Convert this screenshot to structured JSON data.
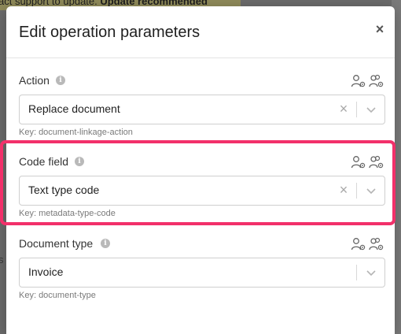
{
  "background": {
    "banner_text": "act support to update. ",
    "banner_bold": "Update recommended",
    "edge_letters": [
      "c",
      "s"
    ]
  },
  "modal": {
    "title": "Edit operation parameters",
    "close_label": "×"
  },
  "fields": [
    {
      "label": "Action",
      "value": "Replace document",
      "key": "Key:  document-linkage-action",
      "clearable": true
    },
    {
      "label": "Code field",
      "value": "Text type code",
      "key": "Key:  metadata-type-code",
      "clearable": true
    },
    {
      "label": "Document type",
      "value": "Invoice",
      "key": "Key:  document-type",
      "clearable": false
    }
  ],
  "icons": {
    "info": "info-icon",
    "acl_user": "user-settings-icon",
    "acl_group": "group-settings-icon",
    "clear": "clear-icon",
    "dropdown": "chevron-down-icon",
    "close": "close-icon"
  },
  "colors": {
    "highlight": "#f2306a",
    "banner": "#f4e27a"
  }
}
